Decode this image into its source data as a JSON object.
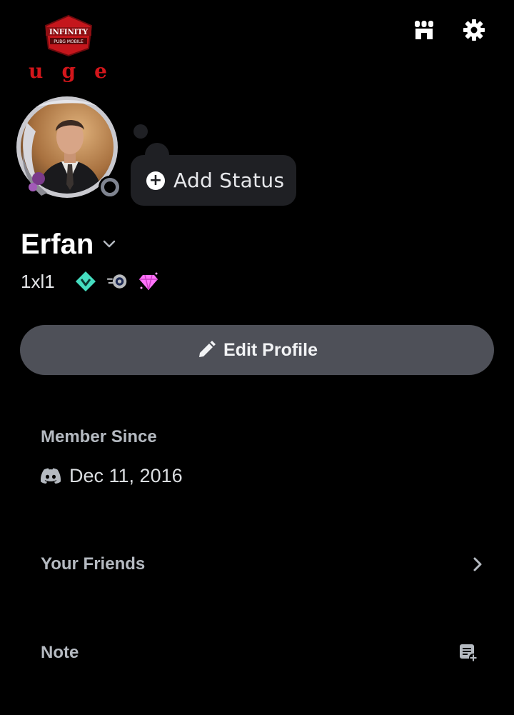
{
  "clan": {
    "logo_text_top": "INFINITY",
    "logo_text_bottom": "PUBG MOBILE",
    "letters": [
      "u",
      "g",
      "e"
    ]
  },
  "header": {
    "shop_icon": "shop-icon",
    "settings_icon": "gear-icon"
  },
  "status": {
    "add_label": "Add Status",
    "presence": "offline"
  },
  "profile": {
    "display_name": "Erfan",
    "username": "1xl1",
    "badges": [
      "hypesquad-balance-badge",
      "nitro-boost-badge",
      "server-booster-gem-badge"
    ]
  },
  "actions": {
    "edit_profile_label": "Edit Profile"
  },
  "member_since": {
    "title": "Member Since",
    "date": "Dec 11, 2016"
  },
  "friends": {
    "title": "Your Friends"
  },
  "note": {
    "title": "Note"
  },
  "colors": {
    "background": "#000000",
    "button": "#4e5058",
    "pill": "#1f2024",
    "muted_text": "#b5bac1",
    "clan_red": "#d3161b",
    "hypesquad_teal": "#45ddc0",
    "gem_pink": "#ff73fa"
  }
}
